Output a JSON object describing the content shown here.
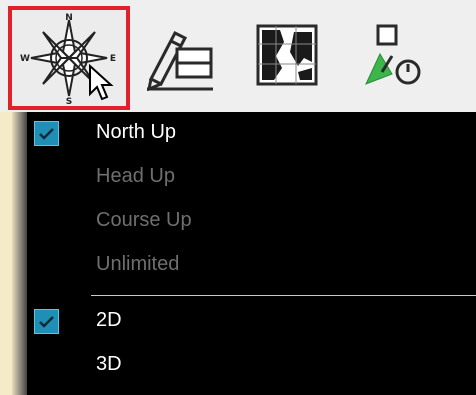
{
  "toolbar": {
    "buttons": [
      {
        "name": "orientation",
        "icon": "compass-rose-icon",
        "active": true
      },
      {
        "name": "edit-layers",
        "icon": "pencil-layers-icon",
        "active": false
      },
      {
        "name": "map-view",
        "icon": "map-chart-icon",
        "active": false
      },
      {
        "name": "route-tool",
        "icon": "waypoint-arrow-icon",
        "active": false
      }
    ],
    "compass_letters": {
      "n": "N",
      "e": "E",
      "s": "S",
      "w": "W"
    }
  },
  "menu": {
    "orientation_items": [
      {
        "label": "North Up",
        "checked": true
      },
      {
        "label": "Head Up",
        "checked": false
      },
      {
        "label": "Course Up",
        "checked": false
      },
      {
        "label": "Unlimited",
        "checked": false
      }
    ],
    "view_items": [
      {
        "label": "2D",
        "checked": true
      },
      {
        "label": "3D",
        "checked": false
      }
    ]
  },
  "colors": {
    "highlight_border": "#e0202a",
    "check_bg": "#1f8fb5",
    "menu_bg": "#000000",
    "checked_text": "#ffffff",
    "unchecked_text": "#6f6f6f"
  }
}
